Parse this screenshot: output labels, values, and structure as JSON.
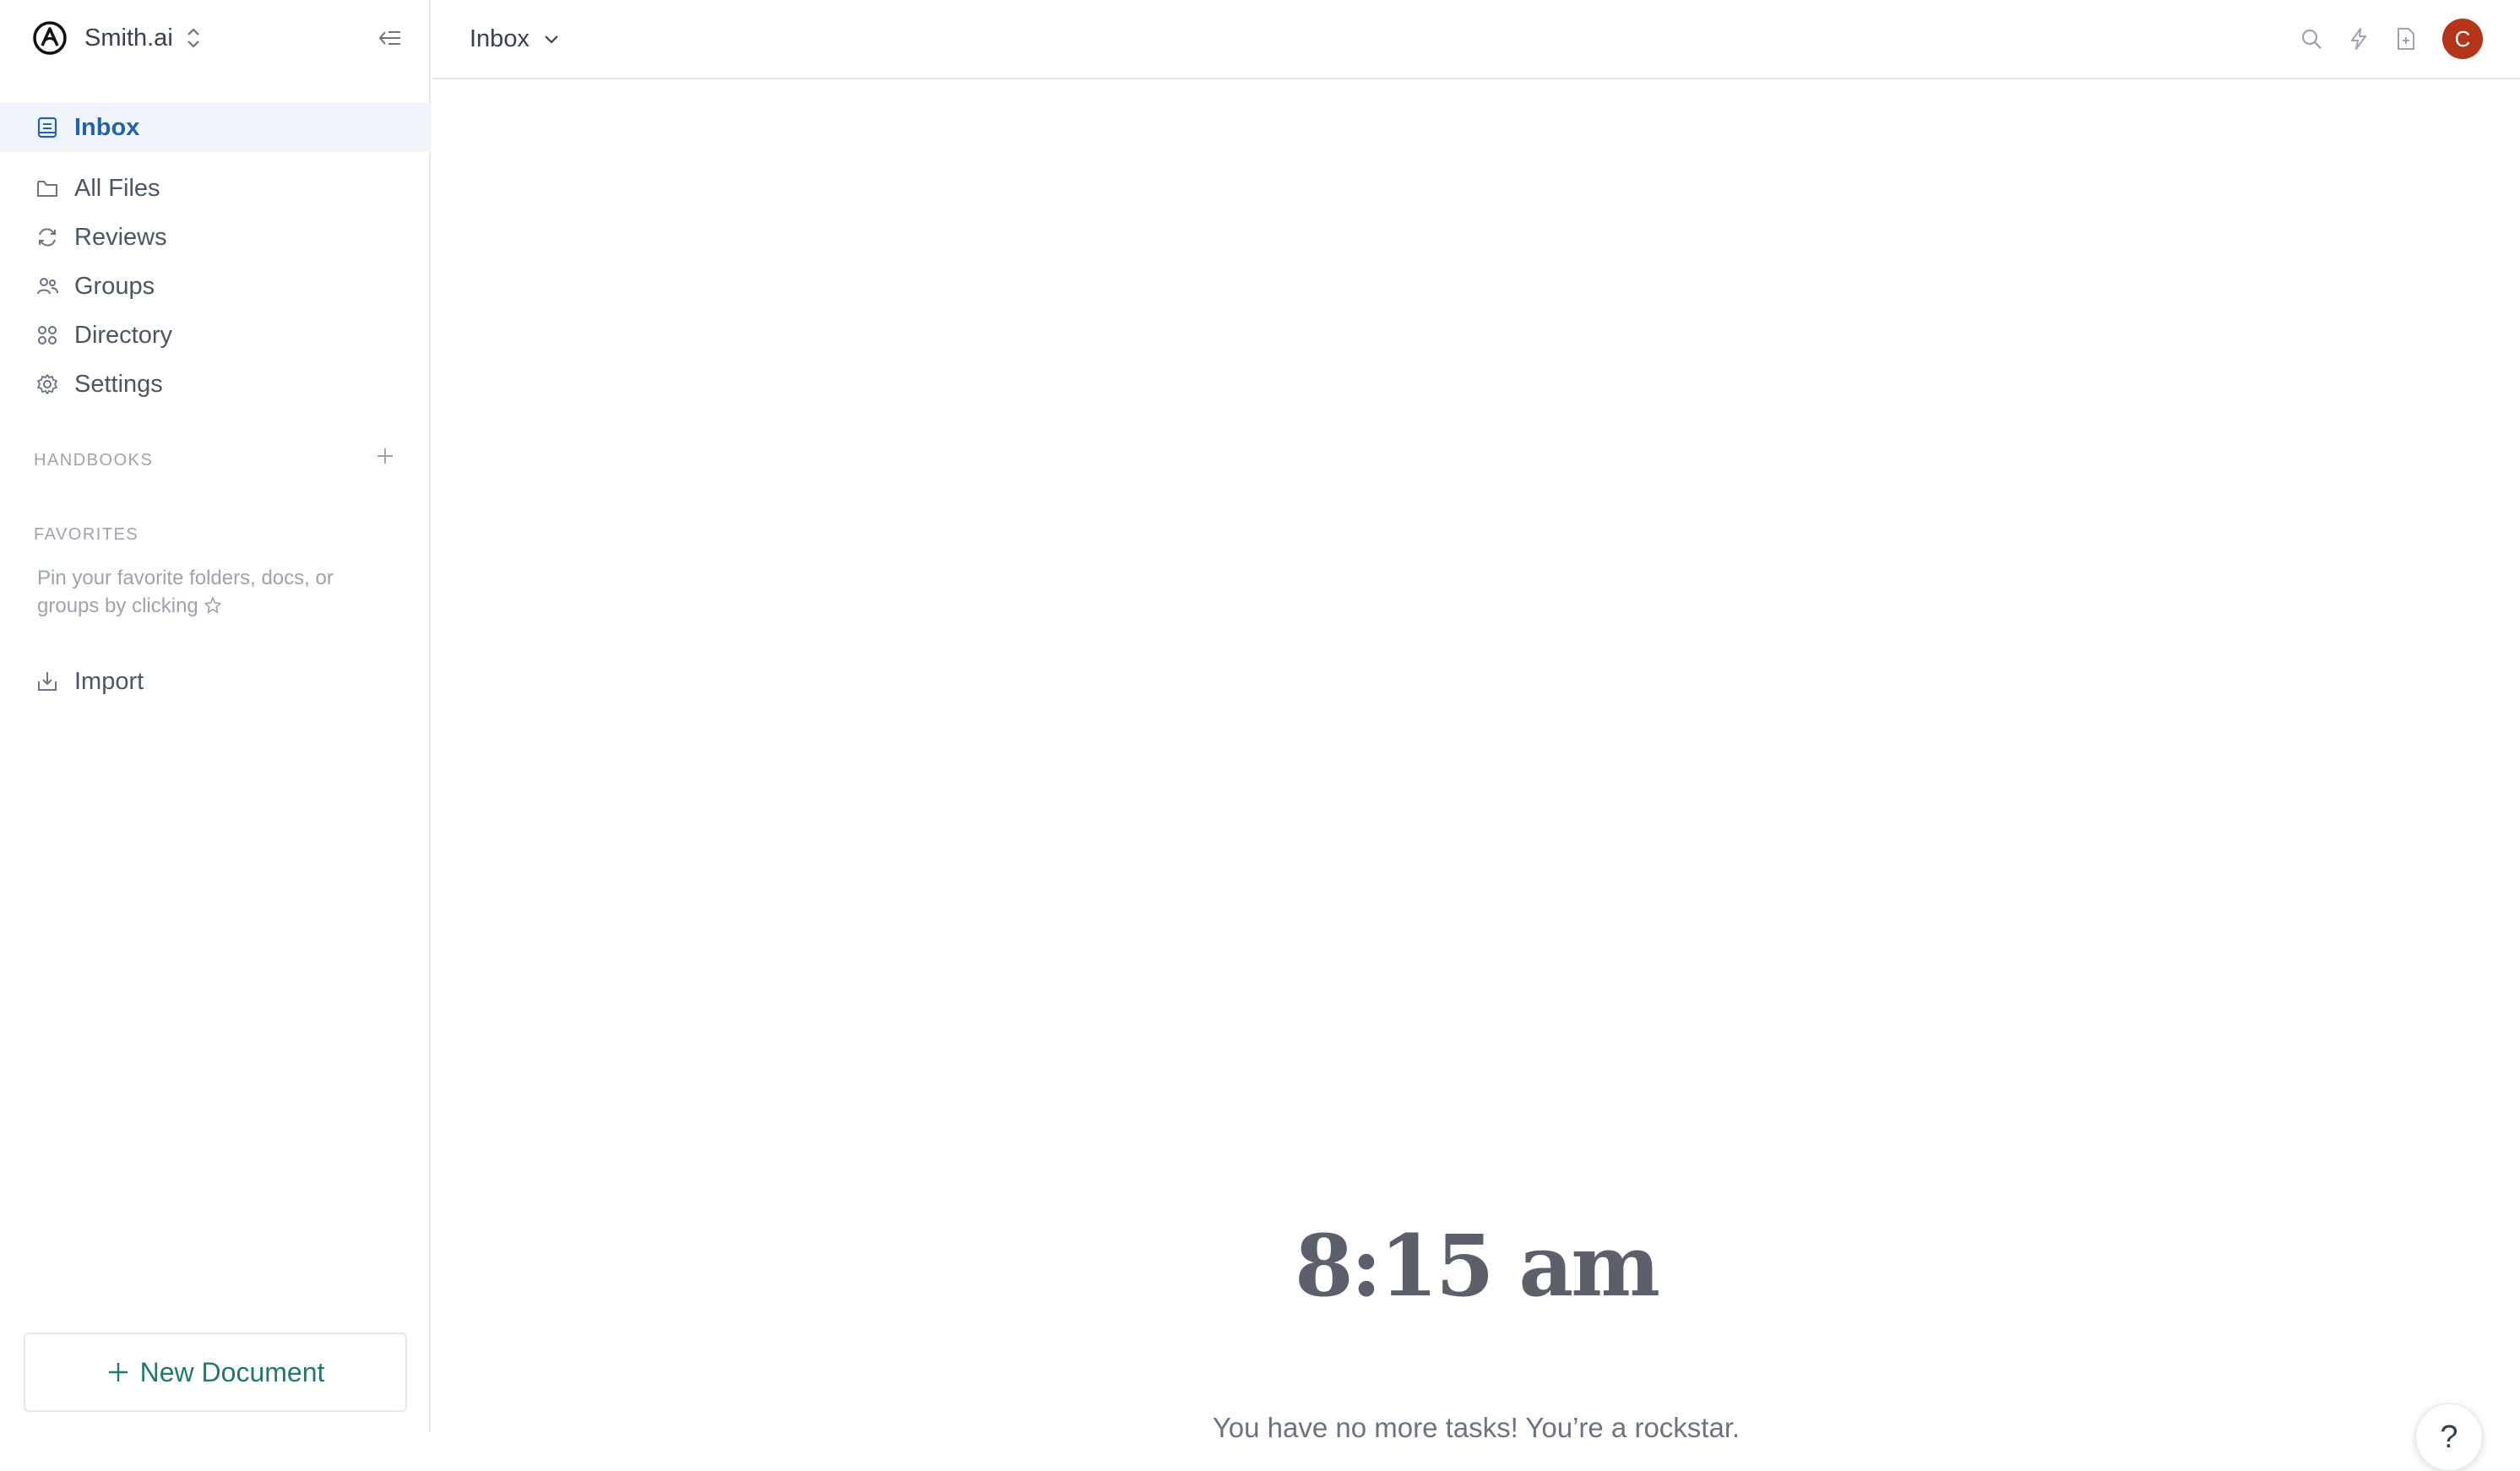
{
  "workspace": {
    "name": "Smith.ai"
  },
  "sidebar": {
    "items": [
      {
        "label": "Inbox",
        "icon": "inbox-icon",
        "active": true
      },
      {
        "label": "All Files",
        "icon": "folder-icon"
      },
      {
        "label": "Reviews",
        "icon": "refresh-icon"
      },
      {
        "label": "Groups",
        "icon": "users-icon"
      },
      {
        "label": "Directory",
        "icon": "directory-icon"
      },
      {
        "label": "Settings",
        "icon": "gear-icon"
      }
    ],
    "handbooks_label": "HANDBOOKS",
    "favorites_label": "FAVORITES",
    "favorites_hint": "Pin your favorite folders, docs, or groups by clicking",
    "import_label": "Import",
    "new_document_label": "New Document"
  },
  "header": {
    "title": "Inbox",
    "avatar_initial": "C"
  },
  "main": {
    "time": "8:15 am",
    "message": "You have no more tasks! You’re a rockstar.",
    "help_label": "?"
  },
  "colors": {
    "accent": "#2563a8",
    "active_bg": "#eff5fb",
    "avatar": "#b5341a",
    "new_doc": "#1f7a6d"
  }
}
